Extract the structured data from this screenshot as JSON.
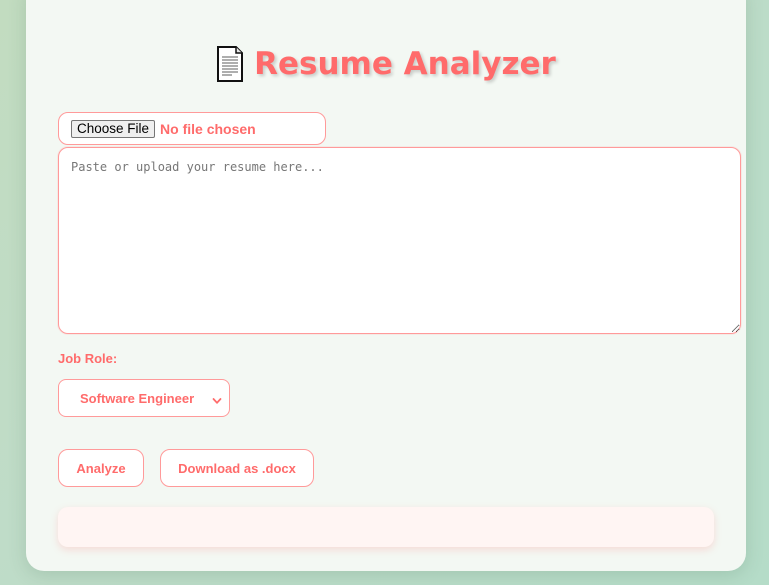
{
  "header": {
    "title": "Resume Analyzer",
    "icon": "document-icon"
  },
  "upload": {
    "button_label": "Choose File",
    "status": "No file chosen"
  },
  "resume": {
    "value": "",
    "placeholder": "Paste or upload your resume here..."
  },
  "job_role": {
    "label": "Job Role:",
    "selected": "Software Engineer"
  },
  "actions": {
    "analyze_label": "Analyze",
    "download_label": "Download as .docx"
  },
  "result": {
    "text": ""
  },
  "colors": {
    "accent": "#ff6b6b",
    "border": "#ff9a9a",
    "card_bg": "#f3f8f3",
    "page_bg": "#bfdcc8",
    "result_bg": "#fff5f3"
  }
}
